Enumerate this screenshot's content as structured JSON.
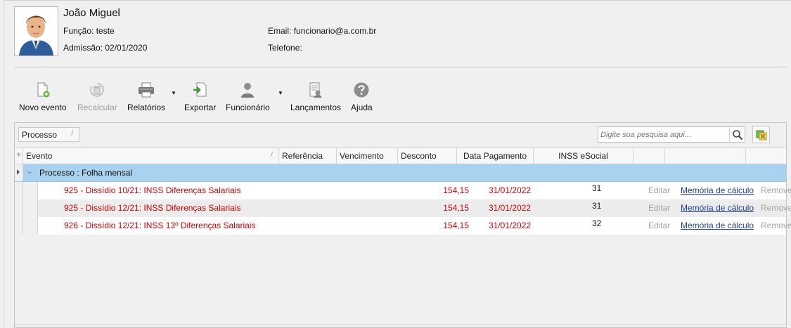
{
  "employee": {
    "name": "João Miguel",
    "funcao_label": "Função:",
    "funcao_value": "teste",
    "admissao_label": "Admissão:",
    "admissao_value": "02/01/2020",
    "email_label": "Email:",
    "email_value": "funcionario@a.com.br",
    "telefone_label": "Telefone:",
    "telefone_value": ""
  },
  "toolbar": {
    "novo_evento": "Novo evento",
    "recalcular": "Recalcular",
    "relatorios": "Relatórios",
    "exportar": "Exportar",
    "funcionario": "Funcionário",
    "lancamentos": "Lançamentos",
    "ajuda": "Ajuda"
  },
  "grid": {
    "group_by": "Processo",
    "search_placeholder": "Digite sua pesquisa aqui...",
    "columns": [
      "Evento",
      "Referência",
      "Vencimento",
      "Desconto",
      "Data Pagamento",
      "INSS eSocial"
    ],
    "group_label": "Processo : Folha mensal",
    "rows": [
      {
        "evento": "925 - Dissídio 10/21: INSS Diferenças Salariais",
        "referencia": "",
        "vencimento": "",
        "desconto": "154,15",
        "data_pagamento": "31/01/2022",
        "inss_esocial": "31",
        "editar": "Editar",
        "memoria": "Memória de cálculo",
        "remover": "Remover"
      },
      {
        "evento": "925 - Dissídio 12/21: INSS Diferenças Salariais",
        "referencia": "",
        "vencimento": "",
        "desconto": "154,15",
        "data_pagamento": "31/01/2022",
        "inss_esocial": "31",
        "editar": "Editar",
        "memoria": "Memória de cálculo",
        "remover": "Remover"
      },
      {
        "evento": "926 - Dissídio 12/21: INSS 13º Diferenças Salariais",
        "referencia": "",
        "vencimento": "",
        "desconto": "154,15",
        "data_pagamento": "31/01/2022",
        "inss_esocial": "32",
        "editar": "Editar",
        "memoria": "Memória de cálculo",
        "remover": "Remover"
      }
    ]
  },
  "colors": {
    "group_row": "#a9d2f0",
    "event_text": "#d40000",
    "link": "#1f3f9e"
  }
}
